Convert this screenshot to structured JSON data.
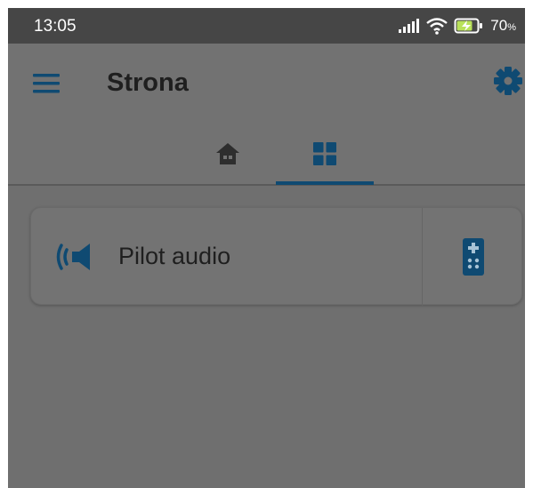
{
  "status": {
    "time": "13:05",
    "battery_text": "70",
    "battery_unit": "%",
    "icons": [
      "signal-icon",
      "wifi-icon",
      "battery-charging-icon"
    ]
  },
  "appbar": {
    "title": "Strona",
    "menu_icon": "menu-icon",
    "settings_icon": "gear-icon"
  },
  "tabs": [
    {
      "icon": "home-icon",
      "selected": false
    },
    {
      "icon": "grid-icon",
      "selected": true
    }
  ],
  "cards": [
    {
      "label": "Pilot audio",
      "icon": "speaker-icon",
      "action_icon": "remote-icon"
    }
  ],
  "colors": {
    "accent": "#0f4a72",
    "overlay_background": "#6f6f6f",
    "statusbar": "#464646",
    "text_primary": "#1f1f1f"
  }
}
